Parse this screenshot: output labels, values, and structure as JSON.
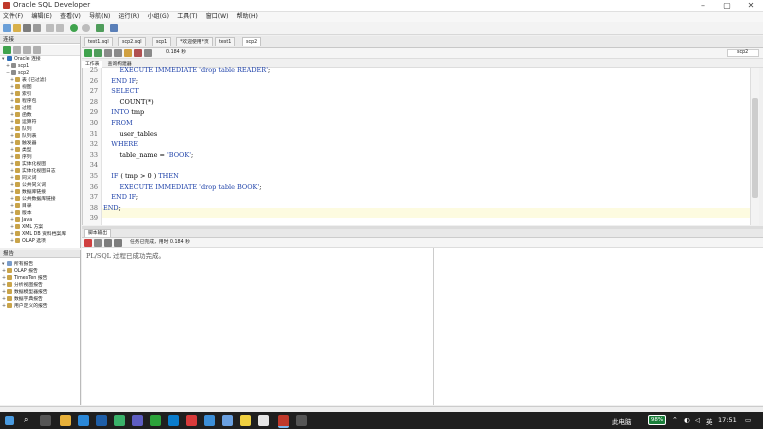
{
  "window": {
    "title": "Oracle SQL Developer"
  },
  "menu": [
    "文件(F)",
    "编辑(E)",
    "查看(V)",
    "导航(N)",
    "运行(R)",
    "小组(G)",
    "工具(T)",
    "窗口(W)",
    "帮助(H)"
  ],
  "connections": {
    "header": "连接",
    "items": [
      {
        "label": "Oracle 连接"
      },
      {
        "label": "scp1"
      },
      {
        "label": "scp2"
      },
      {
        "label": "表 (已过滤)"
      },
      {
        "label": "视图"
      },
      {
        "label": "索引"
      },
      {
        "label": "程序包"
      },
      {
        "label": "过程"
      },
      {
        "label": "函数"
      },
      {
        "label": "运算符"
      },
      {
        "label": "队列"
      },
      {
        "label": "队列表"
      },
      {
        "label": "触发器"
      },
      {
        "label": "类型"
      },
      {
        "label": "序列"
      },
      {
        "label": "实体化视图"
      },
      {
        "label": "实体化视图日志"
      },
      {
        "label": "同义词"
      },
      {
        "label": "公共同义词"
      },
      {
        "label": "数据库链接"
      },
      {
        "label": "公共数据库链接"
      },
      {
        "label": "目录"
      },
      {
        "label": "版本"
      },
      {
        "label": "Java"
      },
      {
        "label": "XML 方案"
      },
      {
        "label": "XML DB 资料档案库"
      },
      {
        "label": "OLAP 选项"
      }
    ]
  },
  "reports": {
    "header": "报告",
    "items": [
      {
        "label": "所有报告"
      },
      {
        "label": "OLAP 报告"
      },
      {
        "label": "TimesTen 报告"
      },
      {
        "label": "分析视图报告"
      },
      {
        "label": "数据模型器报告"
      },
      {
        "label": "数据字典报告"
      },
      {
        "label": "用户定义的报告"
      }
    ]
  },
  "editor_tabs": [
    {
      "label": "test1.sql"
    },
    {
      "label": "scp2.sql"
    },
    {
      "label": "scp1"
    },
    {
      "label": "*欢迎使用*页"
    },
    {
      "label": "test1"
    },
    {
      "label": "scp2"
    }
  ],
  "editor": {
    "timing": "0.184 秒",
    "connection": "scp2",
    "subtabs": [
      "工作表",
      "查询构建器"
    ],
    "lines": [
      {
        "num": "25",
        "text": "        EXECUTE IMMEDIATE 'drop table READER';"
      },
      {
        "num": "26",
        "text": "    END IF;"
      },
      {
        "num": "27",
        "text": "    SELECT"
      },
      {
        "num": "28",
        "text": "        COUNT(*)"
      },
      {
        "num": "29",
        "text": "    INTO tmp"
      },
      {
        "num": "30",
        "text": "    FROM"
      },
      {
        "num": "31",
        "text": "        user_tables"
      },
      {
        "num": "32",
        "text": "    WHERE"
      },
      {
        "num": "33",
        "text": "        table_name = 'BOOK';"
      },
      {
        "num": "34",
        "text": ""
      },
      {
        "num": "35",
        "text": "    IF ( tmp > 0 ) THEN"
      },
      {
        "num": "36",
        "text": "        EXECUTE IMMEDIATE 'drop table BOOK';"
      },
      {
        "num": "37",
        "text": "    END IF;"
      },
      {
        "num": "38",
        "text": "END;"
      },
      {
        "num": "39",
        "text": ""
      }
    ]
  },
  "output": {
    "header": "脚本输出",
    "status": "任务已完成，用时 0.184 秒",
    "message": "PL/SQL 过程已成功完成。"
  },
  "taskbar": {
    "tray_label": "此电脑",
    "battery": "98%",
    "ime": "英",
    "time": "17:51"
  },
  "colors": {
    "keyword": "#1b3fa8",
    "taskbar": "#1f1f1f",
    "highlight_line": "#fdfbe0"
  }
}
